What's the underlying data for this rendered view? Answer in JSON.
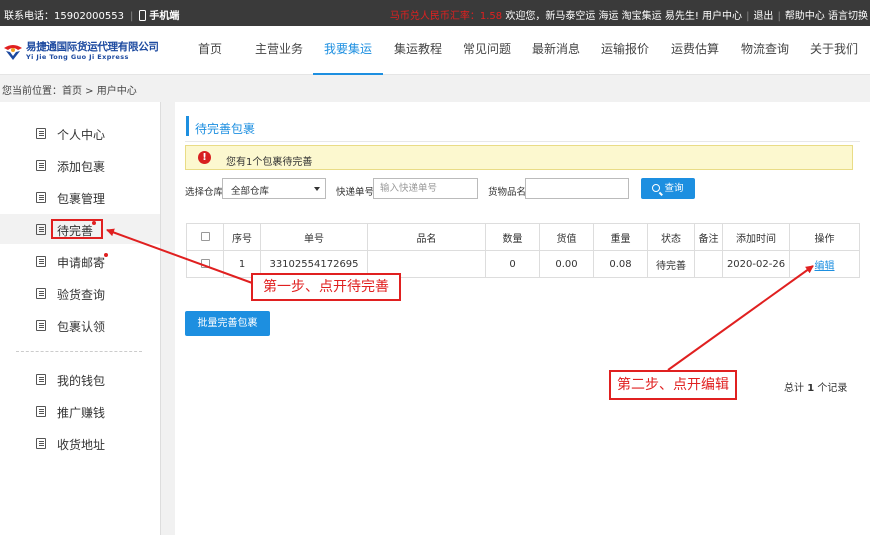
{
  "topbar": {
    "contact": "联系电话：15902000553",
    "mobile": "手机端",
    "rate": "马币兑人民币汇率：1.58",
    "welcome": "欢迎您，新马泰空运 海运 淘宝集运 易先生!",
    "user_center": "用户中心",
    "logout": "退出",
    "help": "帮助中心",
    "language": "语言切换"
  },
  "logo": {
    "name_cn": "易捷通国际货运代理有限公司",
    "name_en": "Yi Jie Tong Guo Ji Express"
  },
  "nav": [
    "首页",
    "主营业务",
    "我要集运",
    "集运教程",
    "常见问题",
    "最新消息",
    "运输报价",
    "运费估算",
    "物流查询",
    "关于我们"
  ],
  "nav_active": "我要集运",
  "breadcrumb": "您当前位置：首页 > 用户中心",
  "sidebar": {
    "items": [
      "个人中心",
      "添加包裹",
      "包裹管理",
      "待完善",
      "申请邮寄",
      "验货查询",
      "包裹认领",
      "我的钱包",
      "推广赚钱",
      "收货地址"
    ],
    "active": "待完善",
    "red_dots": [
      "待完善",
      "申请邮寄"
    ]
  },
  "main": {
    "title": "待完善包裹",
    "notice": "您有1个包裹待完善",
    "filter": {
      "warehouse_label": "选择仓库",
      "warehouse_value": "全部仓库",
      "tracking_label": "快递单号",
      "tracking_placeholder": "输入快递单号",
      "product_label": "货物品名",
      "product_value": "",
      "search_button": "查询"
    },
    "table": {
      "headers": [
        "",
        "序号",
        "单号",
        "品名",
        "数量",
        "货值",
        "重量",
        "状态",
        "备注",
        "添加时间",
        "操作"
      ],
      "rows": [
        [
          "",
          "1",
          "33102554172695",
          "",
          "0",
          "0.00",
          "0.08",
          "待完善",
          "",
          "2020-02-26",
          "编辑"
        ]
      ]
    },
    "batch_button": "批量完善包裹",
    "total": {
      "prefix": "总计",
      "count": "1",
      "suffix": "个记录"
    }
  },
  "annotations": {
    "step1": "第一步、点开待完善",
    "step2": "第二步、点开编辑",
    "color": "#e02020"
  },
  "colors": {
    "accent": "#1d8fe0",
    "topbar": "#3a3a3a",
    "notice_bg": "#fcf8cf"
  }
}
